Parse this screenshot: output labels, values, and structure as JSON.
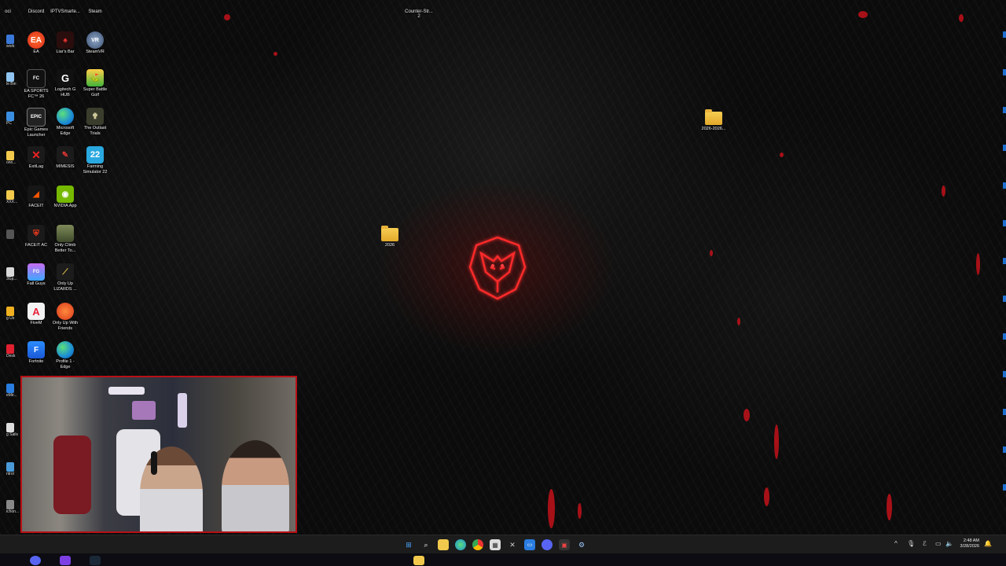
{
  "top_labels": {
    "discord": "Discord",
    "iptv": "IPTVSmarte...",
    "steam": "Steam",
    "counter_strike": "Counter-Str...\n2",
    "left_cut": "oci"
  },
  "icons": {
    "ea": "EA",
    "liars_bar": "Liar's Bar",
    "steamvr": "SteamVR",
    "ea_fc": "EA SPORTS\nFC™ 26",
    "logitech": "Logitech G\nHUB",
    "super_battle": "Super Battle\nGolf",
    "epic": "Epic Games\nLauncher",
    "edge": "Microsoft\nEdge",
    "outlast": "The Outlast\nTrials",
    "exitlag": "ExitLag",
    "mimesis": "MIMESIS",
    "farming": "Farming\nSimulator 22",
    "faceit": "FACEIT",
    "nvidia": "NVIDIA App",
    "faceit_ac": "FACEIT AC",
    "only_climb": "Only Climb\nBetter To...",
    "fall_guys": "Fall Guys",
    "only_up_lizards": "Only Up\nLIZARDS ...",
    "fivem": "FiveM",
    "only_up_friends": "Only Up With\nFriends",
    "fortnite": "Fortnite",
    "profile_edge": "Profile 1 -\nEdge"
  },
  "left_edge_labels": [
    "work",
    "le Bin",
    "PC",
    "onn...",
    "XXX...",
    "",
    "3Gp...",
    "g Us",
    "Desk",
    "eMir...",
    "g Sails",
    "ntrol",
    "ichon..."
  ],
  "folders": {
    "folder_2026": "2026",
    "folder_2026_dated": "2026-2026..."
  },
  "taskbar": {
    "clock_time": "2:48 AM",
    "clock_date": "3/28/2026",
    "tray_chevron": "^"
  },
  "colors": {
    "accent_red": "#c2121a",
    "taskbar_bg": "#1c1c1c",
    "folder_yellow": "#f6cd52"
  }
}
